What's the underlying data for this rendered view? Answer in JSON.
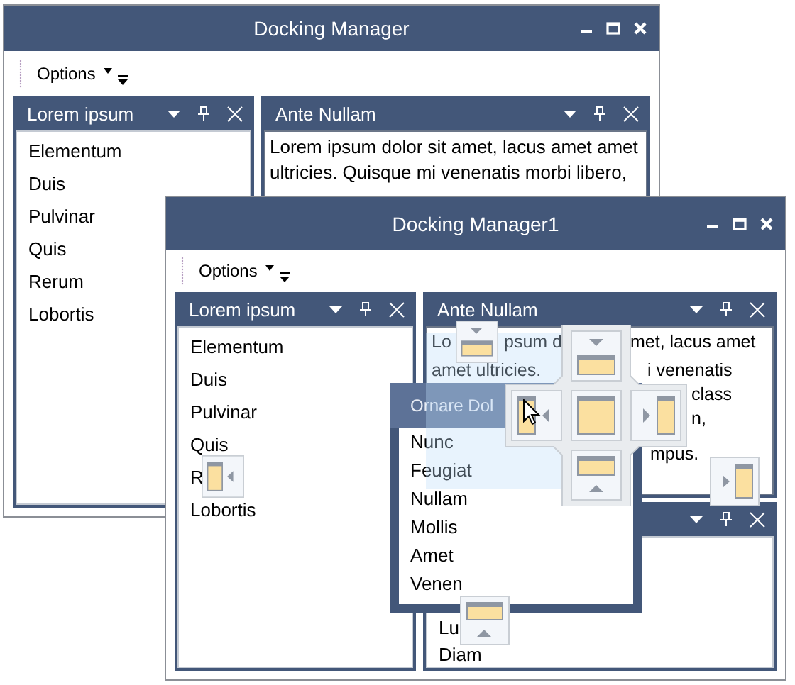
{
  "windows": [
    {
      "title": "Docking Manager",
      "toolbar": {
        "menu": "Options"
      },
      "left_pane": {
        "title": "Lorem ipsum",
        "items": [
          "Elementum",
          "Duis",
          "Pulvinar",
          "Quis",
          "Rerum",
          "Lobortis"
        ]
      },
      "right_panes": [
        {
          "kind": "text",
          "title": "Ante Nullam",
          "text": "Lorem ipsum dolor sit amet, lacus amet amet ultricies. Quisque mi venenatis morbi libero,"
        }
      ]
    },
    {
      "title": "Docking Manager1",
      "toolbar": {
        "menu": "Options"
      },
      "left_pane": {
        "title": "Lorem ipsum",
        "items": [
          "Elementum",
          "Duis",
          "Pulvinar",
          "Quis",
          "R",
          "Lobortis"
        ]
      },
      "right_panes": [
        {
          "kind": "fragments",
          "title": "Ante Nullam",
          "lines": [
            [
              "Lo",
              "psum d",
              "met, lacus amet"
            ],
            [
              "amet ultricies.",
              "i venenatis"
            ],
            [
              "class"
            ],
            [
              "n,"
            ],
            [
              "mpus."
            ]
          ]
        },
        {
          "kind": "list",
          "items": [
            "Lu",
            "Diam"
          ]
        }
      ]
    }
  ],
  "floating_pane": {
    "title": "Ornare Dol",
    "items": [
      "Nunc",
      "Feugiat",
      "Nullam",
      "Mollis",
      "Amet",
      "Venen"
    ]
  }
}
